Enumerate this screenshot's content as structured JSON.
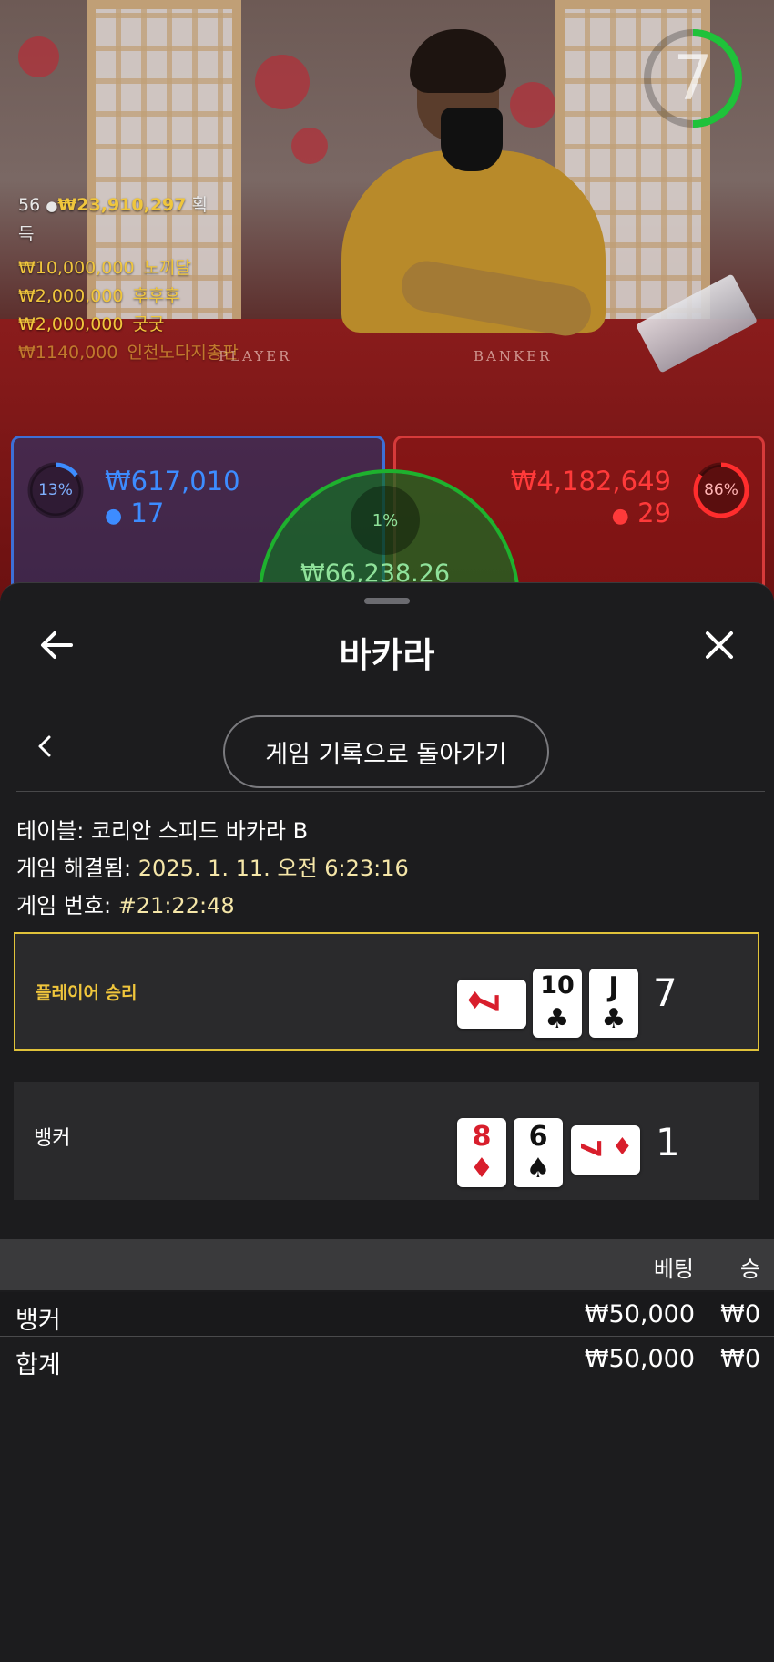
{
  "video": {
    "timer_value": "7",
    "felt_labels": {
      "player": "PLAYER",
      "banker": "BANKER"
    },
    "winners": {
      "count": "56",
      "total": "₩23,910,297",
      "suffix": "획득",
      "rows": [
        {
          "amount": "₩10,000,000",
          "name": "노끼달"
        },
        {
          "amount": "₩2,000,000",
          "name": "후후후"
        },
        {
          "amount": "₩2,000,000",
          "name": "굿굿"
        },
        {
          "amount": "₩1140,000",
          "name": "인천노다지총판"
        }
      ]
    },
    "player_bets": {
      "percent": "13%",
      "amount": "₩617,010",
      "users": "17"
    },
    "banker_bets": {
      "percent": "86%",
      "amount": "₩4,182,649",
      "users": "29"
    },
    "tie_bets": {
      "percent": "1%",
      "amount": "₩66,238.26"
    }
  },
  "sheet": {
    "title": "바카라",
    "back_to_history": "게임 기록으로 돌아가기",
    "table_label": "테이블:",
    "table_value": "코리안 스피드 바카라 B",
    "resolved_label": "게임 해결됨:",
    "resolved_value": "2025. 1. 11. 오전 6:23:16",
    "game_number_label": "게임 번호:",
    "game_number_value": "#21:22:48",
    "player": {
      "label": "플레이어 승리",
      "cards": [
        {
          "rank": "7",
          "suit": "♦",
          "orientation": "side"
        },
        {
          "rank": "10",
          "suit": "♣",
          "orientation": "upright"
        },
        {
          "rank": "J",
          "suit": "♣",
          "orientation": "upright"
        }
      ],
      "score": "7"
    },
    "banker": {
      "label": "뱅커",
      "cards": [
        {
          "rank": "8",
          "suit": "♦",
          "orientation": "upright"
        },
        {
          "rank": "6",
          "suit": "♠",
          "orientation": "upright"
        },
        {
          "rank": "7",
          "suit": "♦",
          "orientation": "side"
        }
      ],
      "score": "1"
    },
    "bets_table": {
      "columns": {
        "stake": "베팅",
        "win": "승"
      },
      "rows": [
        {
          "label": "뱅커",
          "stake": "₩50,000",
          "win": "₩0"
        },
        {
          "label": "합계",
          "stake": "₩50,000",
          "win": "₩0"
        }
      ]
    }
  },
  "colors": {
    "accent_gold": "#f0c63c",
    "player_blue": "#3d6fd6",
    "banker_red": "#d63a3a",
    "tie_green": "#1eb12e",
    "sheet_bg": "#1c1c1e"
  },
  "icons": {
    "back": "arrow-left-icon",
    "close": "close-icon",
    "nav": "chevron-left-icon",
    "user": "user-icon"
  }
}
